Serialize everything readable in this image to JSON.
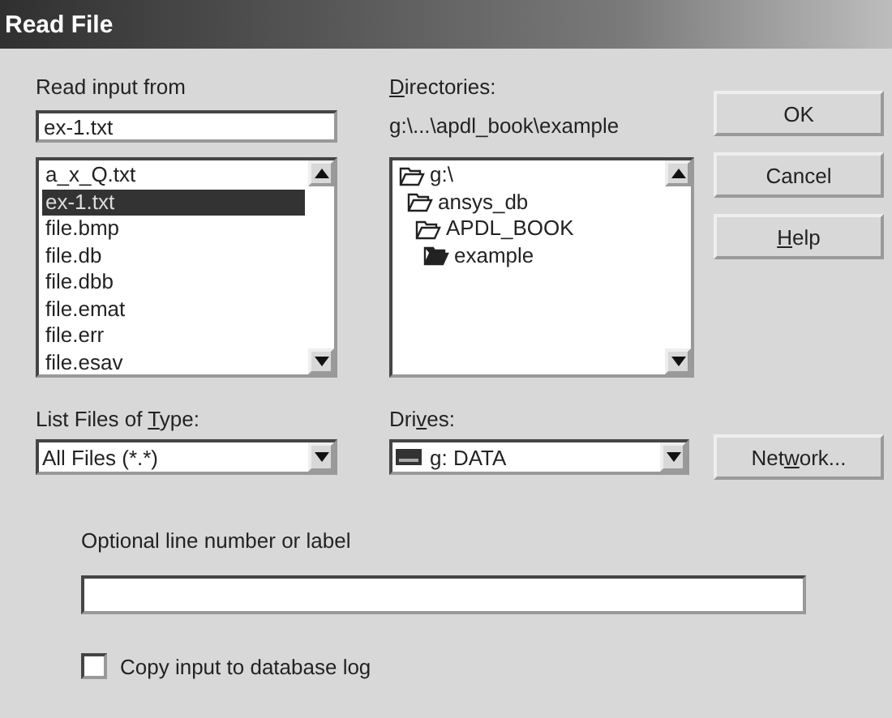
{
  "window": {
    "title": "Read File"
  },
  "read_input": {
    "label": {
      "pre": "Read input from"
    },
    "value": "ex-1.txt"
  },
  "files": [
    {
      "name": "a_x_Q.txt",
      "selected": false
    },
    {
      "name": "ex-1.txt",
      "selected": true
    },
    {
      "name": "file.bmp",
      "selected": false
    },
    {
      "name": "file.db",
      "selected": false
    },
    {
      "name": "file.dbb",
      "selected": false
    },
    {
      "name": "file.emat",
      "selected": false
    },
    {
      "name": "file.err",
      "selected": false
    },
    {
      "name": "file.esav",
      "selected": false
    }
  ],
  "directories": {
    "label": {
      "key": "D",
      "post": "irectories:"
    },
    "path": "g:\\...\\apdl_book\\example",
    "tree": [
      {
        "name": "g:\\",
        "selected": false,
        "children": [
          {
            "name": "ansys_db",
            "selected": false,
            "children": [
              {
                "name": "APDL_BOOK",
                "selected": false,
                "children": [
                  {
                    "name": "example",
                    "selected": true
                  }
                ]
              }
            ]
          }
        ]
      }
    ]
  },
  "buttons": [
    {
      "label": {
        "pre": "OK"
      }
    },
    {
      "label": {
        "pre": "Cancel"
      }
    },
    {
      "label": {
        "key": "H",
        "post": "elp"
      }
    }
  ],
  "file_type": {
    "label": {
      "pre": "List Files of ",
      "key": "T",
      "post": "ype:"
    },
    "value": "All Files (*.*)"
  },
  "drives": {
    "label": {
      "pre": "Dri",
      "key": "v",
      "post": "es:"
    },
    "value": "g: DATA"
  },
  "network_button": {
    "label": {
      "pre": "Net",
      "key": "w",
      "post": "ork..."
    }
  },
  "line_label": {
    "label": "Optional line number or label"
  },
  "copy_log": {
    "label": "Copy input to database log",
    "checked": false
  }
}
